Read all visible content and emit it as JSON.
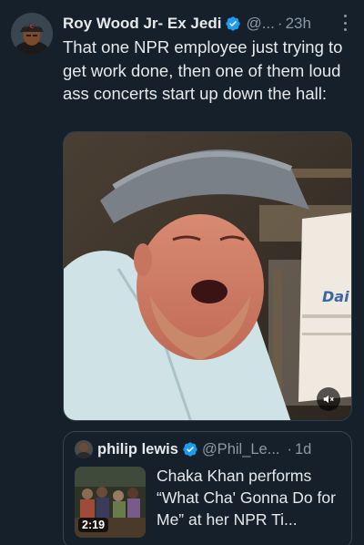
{
  "tweet": {
    "author": {
      "display_name": "Roy Wood Jr- Ex Jedi",
      "handle": "@...",
      "verified": true
    },
    "time": "23h",
    "separator": "·",
    "text": "That one NPR employee just trying to get work done, then one of them loud ass concerts start up down the hall:",
    "media": {
      "type": "video",
      "overlay_text": "Dai",
      "mute_icon": "speaker-muted-icon"
    },
    "more_icon": "more-vertical-icon"
  },
  "quote": {
    "author": {
      "display_name": "philip lewis",
      "handle": "@Phil_Le...",
      "verified": true
    },
    "separator": "·",
    "time": "1d",
    "video_duration": "2:19",
    "text": "Chaka Khan performs “What Cha' Gonna Do for Me” at her NPR Ti..."
  },
  "colors": {
    "background": "#15202b",
    "verified_badge": "#1d9bf0",
    "secondary_text": "#8b98a5",
    "primary_text": "#e7e9ea"
  }
}
